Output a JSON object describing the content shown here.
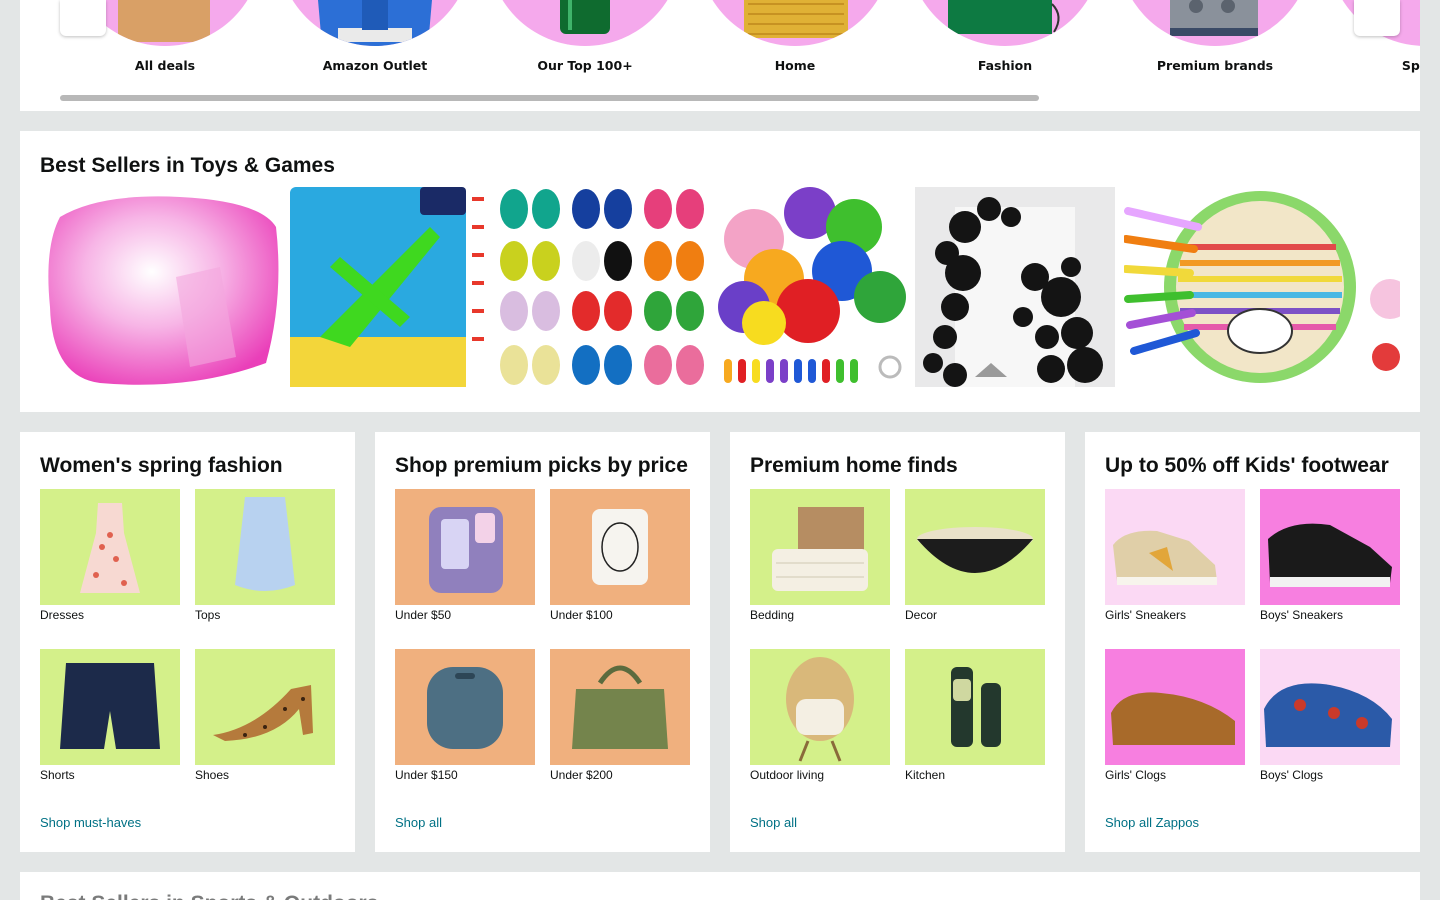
{
  "deals": {
    "items": [
      {
        "label": "All deals",
        "icon": "box-icon"
      },
      {
        "label": "Amazon Outlet",
        "icon": "hoodie-icon"
      },
      {
        "label": "Our Top 100+",
        "icon": "bottle-icon"
      },
      {
        "label": "Home",
        "icon": "pillow-icon"
      },
      {
        "label": "Fashion",
        "icon": "bag-icon"
      },
      {
        "label": "Premium brands",
        "icon": "espresso-machine-icon"
      },
      {
        "label": "Spring",
        "icon": "spring-icon"
      }
    ],
    "accent": "#f5a9ec"
  },
  "bestsellers": {
    "title": "Best Sellers in Toys & Games"
  },
  "cards": [
    {
      "title": "Women's spring fashion",
      "tiles": [
        {
          "label": "Dresses",
          "bg": "#d4f08a"
        },
        {
          "label": "Tops",
          "bg": "#d4f08a"
        },
        {
          "label": "Shorts",
          "bg": "#d4f08a"
        },
        {
          "label": "Shoes",
          "bg": "#d4f08a"
        }
      ],
      "link": "Shop must-haves"
    },
    {
      "title": "Shop premium picks by price",
      "tiles": [
        {
          "label": "Under $50",
          "bg": "#f0b07e"
        },
        {
          "label": "Under $100",
          "bg": "#f0b07e"
        },
        {
          "label": "Under $150",
          "bg": "#f0b07e"
        },
        {
          "label": "Under $200",
          "bg": "#f0b07e"
        }
      ],
      "link": "Shop all"
    },
    {
      "title": "Premium home finds",
      "tiles": [
        {
          "label": "Bedding",
          "bg": "#d4f08a"
        },
        {
          "label": "Decor",
          "bg": "#d4f08a"
        },
        {
          "label": "Outdoor living",
          "bg": "#d4f08a"
        },
        {
          "label": "Kitchen",
          "bg": "#d4f08a"
        }
      ],
      "link": "Shop all"
    },
    {
      "title": "Up to 50% off Kids' footwear",
      "tiles": [
        {
          "label": "Girls' Sneakers",
          "bg": "#fbd9f4"
        },
        {
          "label": "Boys' Sneakers",
          "bg": "#f77fe0"
        },
        {
          "label": "Girls' Clogs",
          "bg": "#f77fe0"
        },
        {
          "label": "Boys' Clogs",
          "bg": "#fbd9f4"
        }
      ],
      "link": "Shop all Zappos"
    }
  ],
  "bottom": {
    "title": "Best Sellers in Sports & Outdoors"
  },
  "colors": {
    "page_bg": "#e3e6e6",
    "link": "#007185"
  }
}
